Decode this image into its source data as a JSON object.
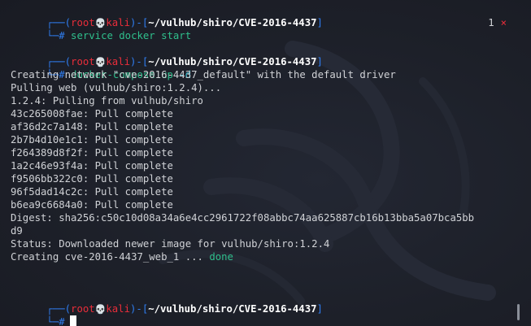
{
  "prompt": {
    "corner_top": "┌──",
    "corner_bottom": "└─",
    "user": "root",
    "skull": "💀",
    "host": "kali",
    "dash": "-",
    "path": "~/vulhub/shiro/CVE-2016-4437",
    "hash": "#"
  },
  "blocks": [
    {
      "command": "service docker start",
      "exit_code": "1",
      "exit_icon": "×"
    },
    {
      "command_prog": "docker-compose",
      "command_args": " up ",
      "command_flag": "-d",
      "output": [
        "Creating network \"cve-2016-4437_default\" with the default driver",
        "Pulling web (vulhub/shiro:1.2.4)...",
        "1.2.4: Pulling from vulhub/shiro",
        "43c265008fae: Pull complete",
        "af36d2c7a148: Pull complete",
        "2b7b4d10e1c1: Pull complete",
        "f264389d8f2f: Pull complete",
        "1a2c46e93f4a: Pull complete",
        "f9506bb322c0: Pull complete",
        "96f5dad14c2c: Pull complete",
        "b6ea9c6684a0: Pull complete",
        "Digest: sha256:c50c10d08a34a6e4cc2961722f08abbc74aa625887cb16b13bba5a07bca5bb",
        "d9",
        "Status: Downloaded newer image for vulhub/shiro:1.2.4"
      ],
      "final_prefix": "Creating cve-2016-4437_web_1 ... ",
      "final_status": "done"
    }
  ],
  "colors": {
    "background": "#1b1e28",
    "prompt_frame": "#2f7df0",
    "user_host": "#ea2d3a",
    "command": "#2fbf8c",
    "text": "#d0d2d6"
  }
}
